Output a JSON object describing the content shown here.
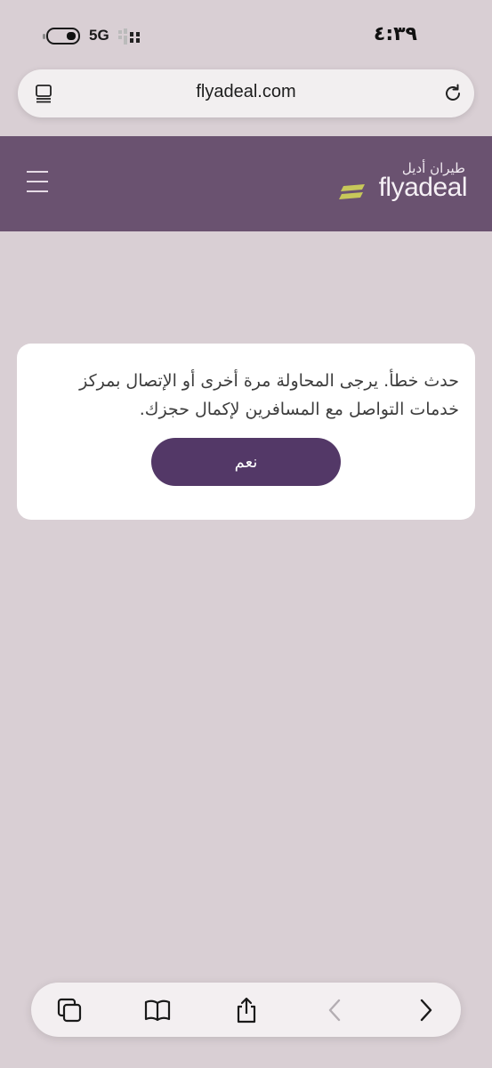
{
  "status_bar": {
    "network": "5G",
    "time": "٤:٣٩"
  },
  "browser": {
    "url": "flyadeal.com"
  },
  "header": {
    "logo_arabic": "طيران أديل",
    "logo_latin": "flyadeal",
    "brand_color": "#6a5270",
    "accent_color": "#c7c85a"
  },
  "dialog": {
    "message": "حدث خطأ. يرجى المحاولة مرة أخرى أو الإتصال بمركز خدمات التواصل مع المسافرين لإكمال حجزك.",
    "confirm_label": "نعم",
    "button_color": "#533867"
  },
  "toolbar": {
    "icons": [
      "tabs-icon",
      "bookmarks-icon",
      "share-icon",
      "back-icon",
      "forward-icon"
    ]
  }
}
